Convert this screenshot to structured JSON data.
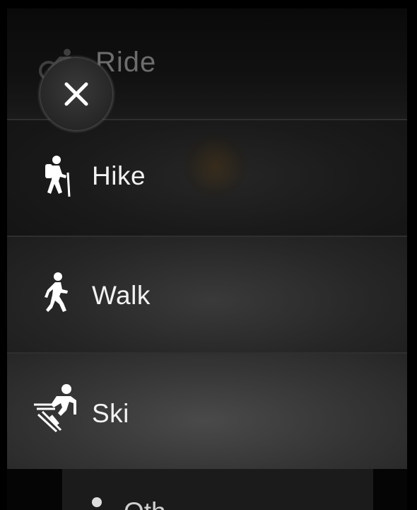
{
  "close_button": {
    "icon": "close-icon"
  },
  "top_item": {
    "label": "Ride",
    "icon": "bike-icon"
  },
  "items": [
    {
      "label": "Hike",
      "icon": "hike-icon"
    },
    {
      "label": "Walk",
      "icon": "walk-icon"
    },
    {
      "label": "Ski",
      "icon": "ski-icon"
    }
  ],
  "bottom_item": {
    "label": "Oth",
    "icon": "other-icon"
  }
}
